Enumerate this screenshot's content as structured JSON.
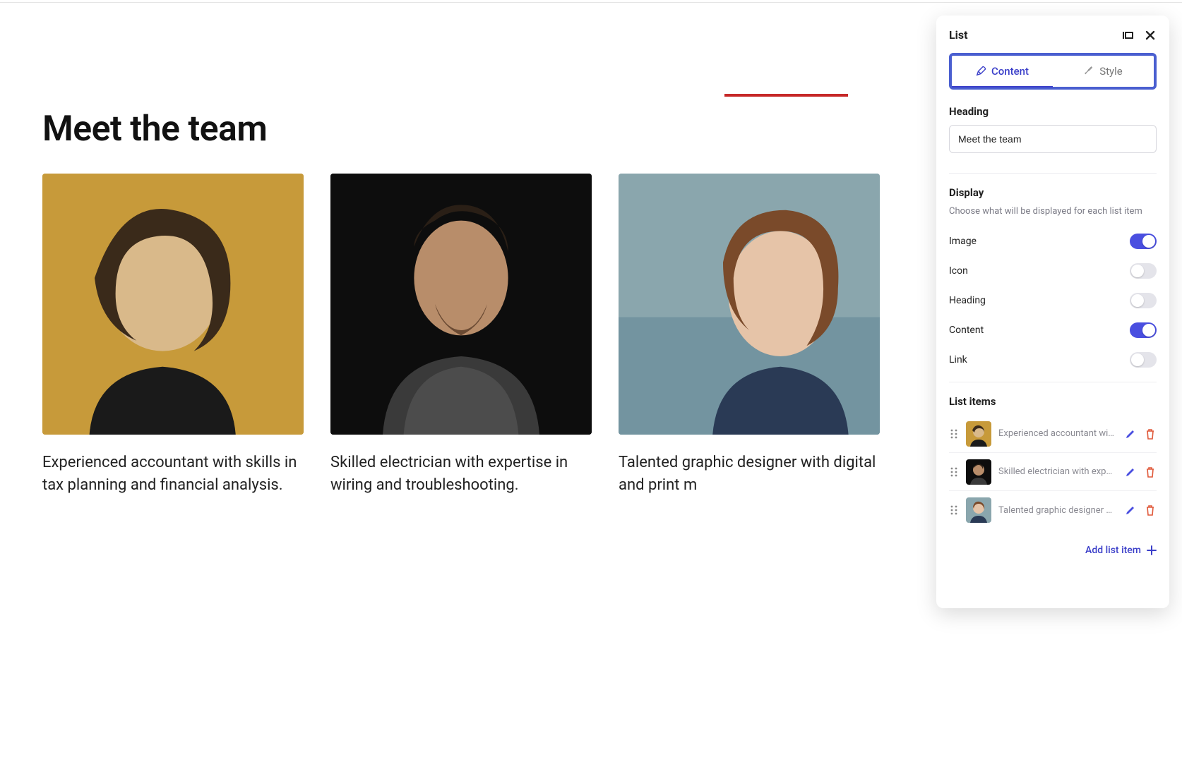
{
  "canvas": {
    "heading": "Meet the team",
    "cards": [
      {
        "caption": "Experienced accountant with skills in tax planning and financial analysis."
      },
      {
        "caption": "Skilled electrician with expertise in wiring and troubleshooting."
      },
      {
        "caption": "Talented graphic designer with digital and print m"
      }
    ]
  },
  "panel": {
    "title": "List",
    "tabs": {
      "content": "Content",
      "style": "Style",
      "active": "content"
    },
    "heading_section": {
      "label": "Heading",
      "value": "Meet the team"
    },
    "display_section": {
      "label": "Display",
      "subtext": "Choose what will be displayed for each list item",
      "toggles": [
        {
          "key": "image",
          "label": "Image",
          "on": true
        },
        {
          "key": "icon",
          "label": "Icon",
          "on": false
        },
        {
          "key": "heading",
          "label": "Heading",
          "on": false
        },
        {
          "key": "content",
          "label": "Content",
          "on": true
        },
        {
          "key": "link",
          "label": "Link",
          "on": false
        }
      ]
    },
    "list_items_section": {
      "label": "List items",
      "items": [
        {
          "label": "Experienced accountant with ..."
        },
        {
          "label": "Skilled electrician with experti..."
        },
        {
          "label": "Talented graphic designer wit..."
        }
      ],
      "add_label": "Add list item"
    }
  },
  "colors": {
    "card_bg": [
      "#c79a3a",
      "#0d0d0d",
      "#8aa6ad"
    ]
  }
}
